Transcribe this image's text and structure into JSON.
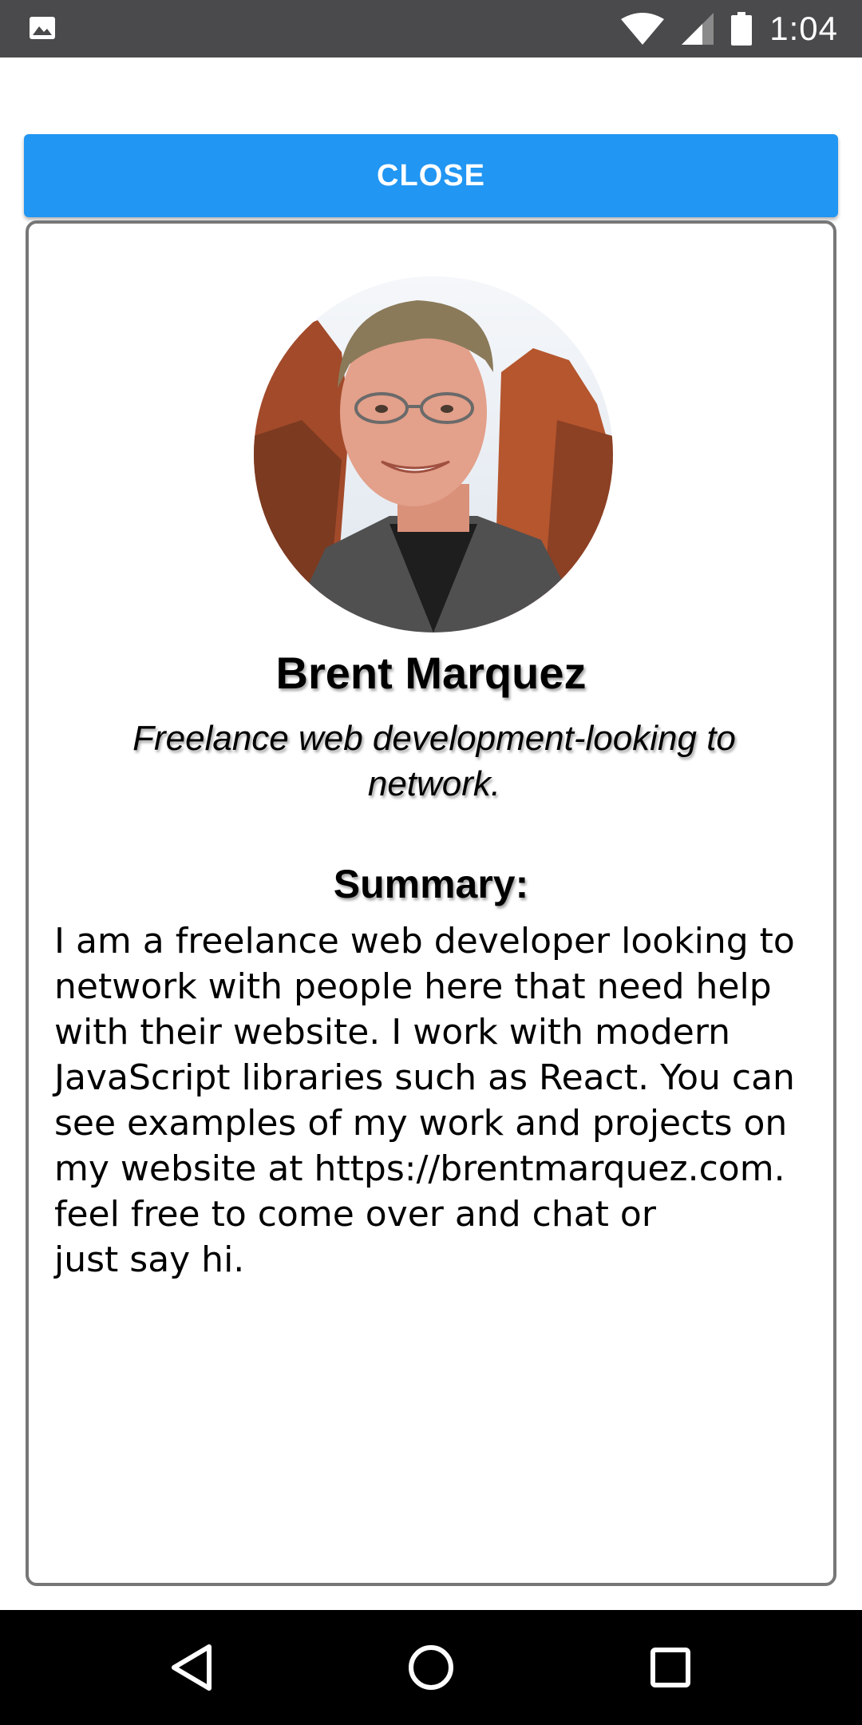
{
  "status_bar": {
    "time": "1:04",
    "icons": [
      "image-icon",
      "wifi-icon",
      "signal-icon",
      "battery-icon"
    ]
  },
  "close_button": {
    "label": "CLOSE"
  },
  "profile": {
    "name": "Brent Marquez",
    "tagline": "Freelance web development-looking to network.",
    "summary_heading": "Summary:",
    "summary_text": "I am a freelance web developer looking to network with people here that need help with their website.  I work with modern JavaScript libraries such as React.  You can see examples of my work and projects on my website at https://brentmarquez.com.\nfeel free to come over and chat or\njust say hi."
  },
  "nav_bar": {
    "icons": [
      "back-icon",
      "home-icon",
      "recents-icon"
    ]
  },
  "colors": {
    "accent": "#2196f3",
    "status_bar": "#4a4a4c",
    "nav_bar": "#000000",
    "card_border": "#777777"
  }
}
